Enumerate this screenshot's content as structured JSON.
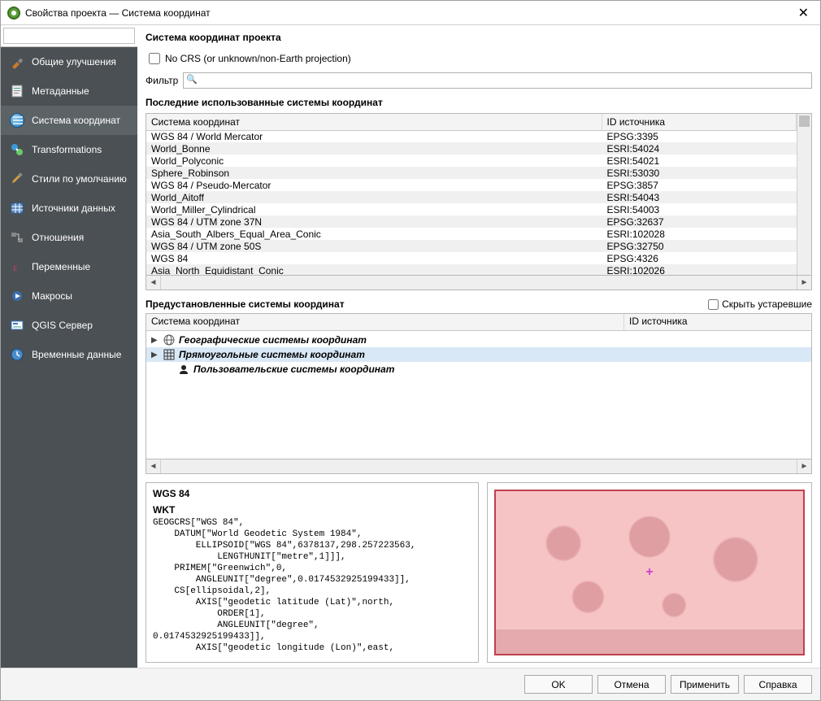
{
  "window": {
    "title": "Свойства проекта — Система координат"
  },
  "sidebar": {
    "search_placeholder": "",
    "items": [
      {
        "label": "Общие улучшения"
      },
      {
        "label": "Метаданные"
      },
      {
        "label": "Система координат"
      },
      {
        "label": "Transformations"
      },
      {
        "label": "Стили по умолчанию"
      },
      {
        "label": "Источники данных"
      },
      {
        "label": "Отношения"
      },
      {
        "label": "Переменные"
      },
      {
        "label": "Макросы"
      },
      {
        "label": "QGIS Сервер"
      },
      {
        "label": "Временные данные"
      }
    ]
  },
  "main": {
    "section_title": "Система координат проекта",
    "no_crs_label": "No CRS (or unknown/non-Earth projection)",
    "filter_label": "Фильтр",
    "filter_value": "",
    "recent_title": "Последние использованные системы координат",
    "columns": {
      "name": "Система координат",
      "id": "ID источника"
    },
    "recent_rows": [
      {
        "name": "WGS 84 / World Mercator",
        "id": "EPSG:3395"
      },
      {
        "name": "World_Bonne",
        "id": "ESRI:54024"
      },
      {
        "name": "World_Polyconic",
        "id": "ESRI:54021"
      },
      {
        "name": "Sphere_Robinson",
        "id": "ESRI:53030"
      },
      {
        "name": "WGS 84 / Pseudo-Mercator",
        "id": "EPSG:3857"
      },
      {
        "name": "World_Aitoff",
        "id": "ESRI:54043"
      },
      {
        "name": "World_Miller_Cylindrical",
        "id": "ESRI:54003"
      },
      {
        "name": "WGS 84 / UTM zone 37N",
        "id": "EPSG:32637"
      },
      {
        "name": "Asia_South_Albers_Equal_Area_Conic",
        "id": "ESRI:102028"
      },
      {
        "name": "WGS 84 / UTM zone 50S",
        "id": "EPSG:32750"
      },
      {
        "name": "WGS 84",
        "id": "EPSG:4326"
      },
      {
        "name": "Asia_North_Equidistant_Conic",
        "id": "ESRI:102026"
      }
    ],
    "predef_title": "Предустановленные системы координат",
    "hide_deprecated_label": "Скрыть устаревшие",
    "tree": [
      {
        "label": "Географические системы координат"
      },
      {
        "label": "Прямоугольные системы координат"
      },
      {
        "label": "Пользовательские системы координат"
      }
    ],
    "selected_crs_name": "WGS 84",
    "wkt_label": "WKT",
    "wkt_text": "GEOGCRS[\"WGS 84\",\n    DATUM[\"World Geodetic System 1984\",\n        ELLIPSOID[\"WGS 84\",6378137,298.257223563,\n            LENGTHUNIT[\"metre\",1]]],\n    PRIMEM[\"Greenwich\",0,\n        ANGLEUNIT[\"degree\",0.0174532925199433]],\n    CS[ellipsoidal,2],\n        AXIS[\"geodetic latitude (Lat)\",north,\n            ORDER[1],\n            ANGLEUNIT[\"degree\",\n0.0174532925199433]],\n        AXIS[\"geodetic longitude (Lon)\",east,"
  },
  "buttons": {
    "ok": "OK",
    "cancel": "Отмена",
    "apply": "Применить",
    "help": "Справка"
  }
}
